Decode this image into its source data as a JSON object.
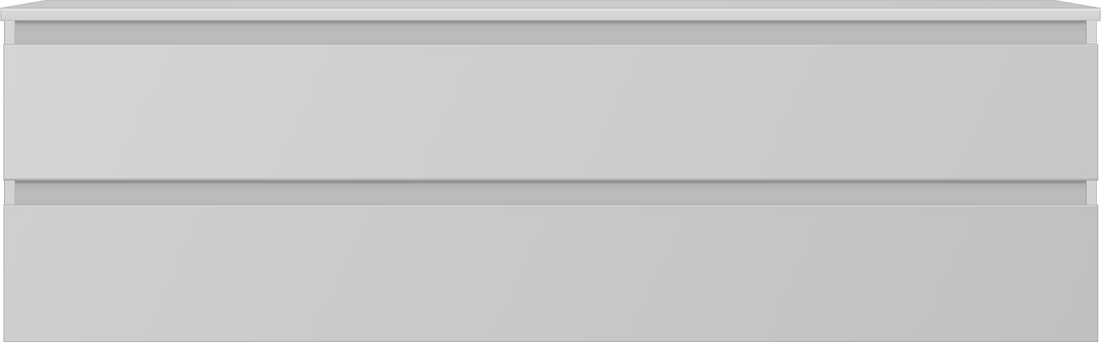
{
  "scene": {
    "subject": "",
    "colors": {
      "countertop_top": "#cfcfcd",
      "countertop_edge": "#d9d9d7",
      "drawer_front": "#cececc",
      "handle_recess": "#b3b3b1",
      "carcass_outline": "#9a9a98"
    },
    "drawers": [
      {
        "position": "upper"
      },
      {
        "position": "lower"
      }
    ]
  }
}
